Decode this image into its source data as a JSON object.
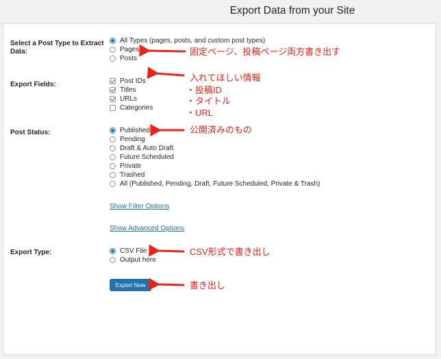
{
  "page": {
    "title": "Export Data from your Site"
  },
  "form": {
    "post_type": {
      "label": "Select a Post Type to Extract Data:",
      "options": [
        {
          "label": "All Types (pages, posts, and custom post types)",
          "selected": true
        },
        {
          "label": "Pages",
          "selected": false
        },
        {
          "label": "Posts",
          "selected": false
        }
      ]
    },
    "export_fields": {
      "label": "Export Fields:",
      "options": [
        {
          "label": "Post IDs",
          "checked": true
        },
        {
          "label": "Titles",
          "checked": true
        },
        {
          "label": "URLs",
          "checked": true
        },
        {
          "label": "Categories",
          "checked": false
        }
      ]
    },
    "post_status": {
      "label": "Post Status:",
      "options": [
        {
          "label": "Published",
          "selected": true
        },
        {
          "label": "Pending",
          "selected": false
        },
        {
          "label": "Draft & Auto Draft",
          "selected": false
        },
        {
          "label": "Future Scheduled",
          "selected": false
        },
        {
          "label": "Private",
          "selected": false
        },
        {
          "label": "Trashed",
          "selected": false
        },
        {
          "label": "All (Published, Pending, Draft, Future Scheduled, Private & Trash)",
          "selected": false
        }
      ]
    },
    "links": {
      "filter": "Show Filter Options",
      "advanced": "Show Advanced Options"
    },
    "export_type": {
      "label": "Export Type:",
      "options": [
        {
          "label": "CSV File",
          "selected": true
        },
        {
          "label": "Output here",
          "selected": false
        }
      ]
    },
    "export_button": "Export Now"
  },
  "annotations": {
    "pages_note": "固定ページ、投稿ページ両方書き出す",
    "fields_note": [
      "入れてほしい情報",
      "・投稿ID",
      "・タイトル",
      "・URL"
    ],
    "status_note": "公開済みのもの",
    "csv_note": "CSV形式で書き出し",
    "export_note": "書き出し"
  },
  "colors": {
    "accent": "#2271b1",
    "annotation": "#e8231b"
  }
}
